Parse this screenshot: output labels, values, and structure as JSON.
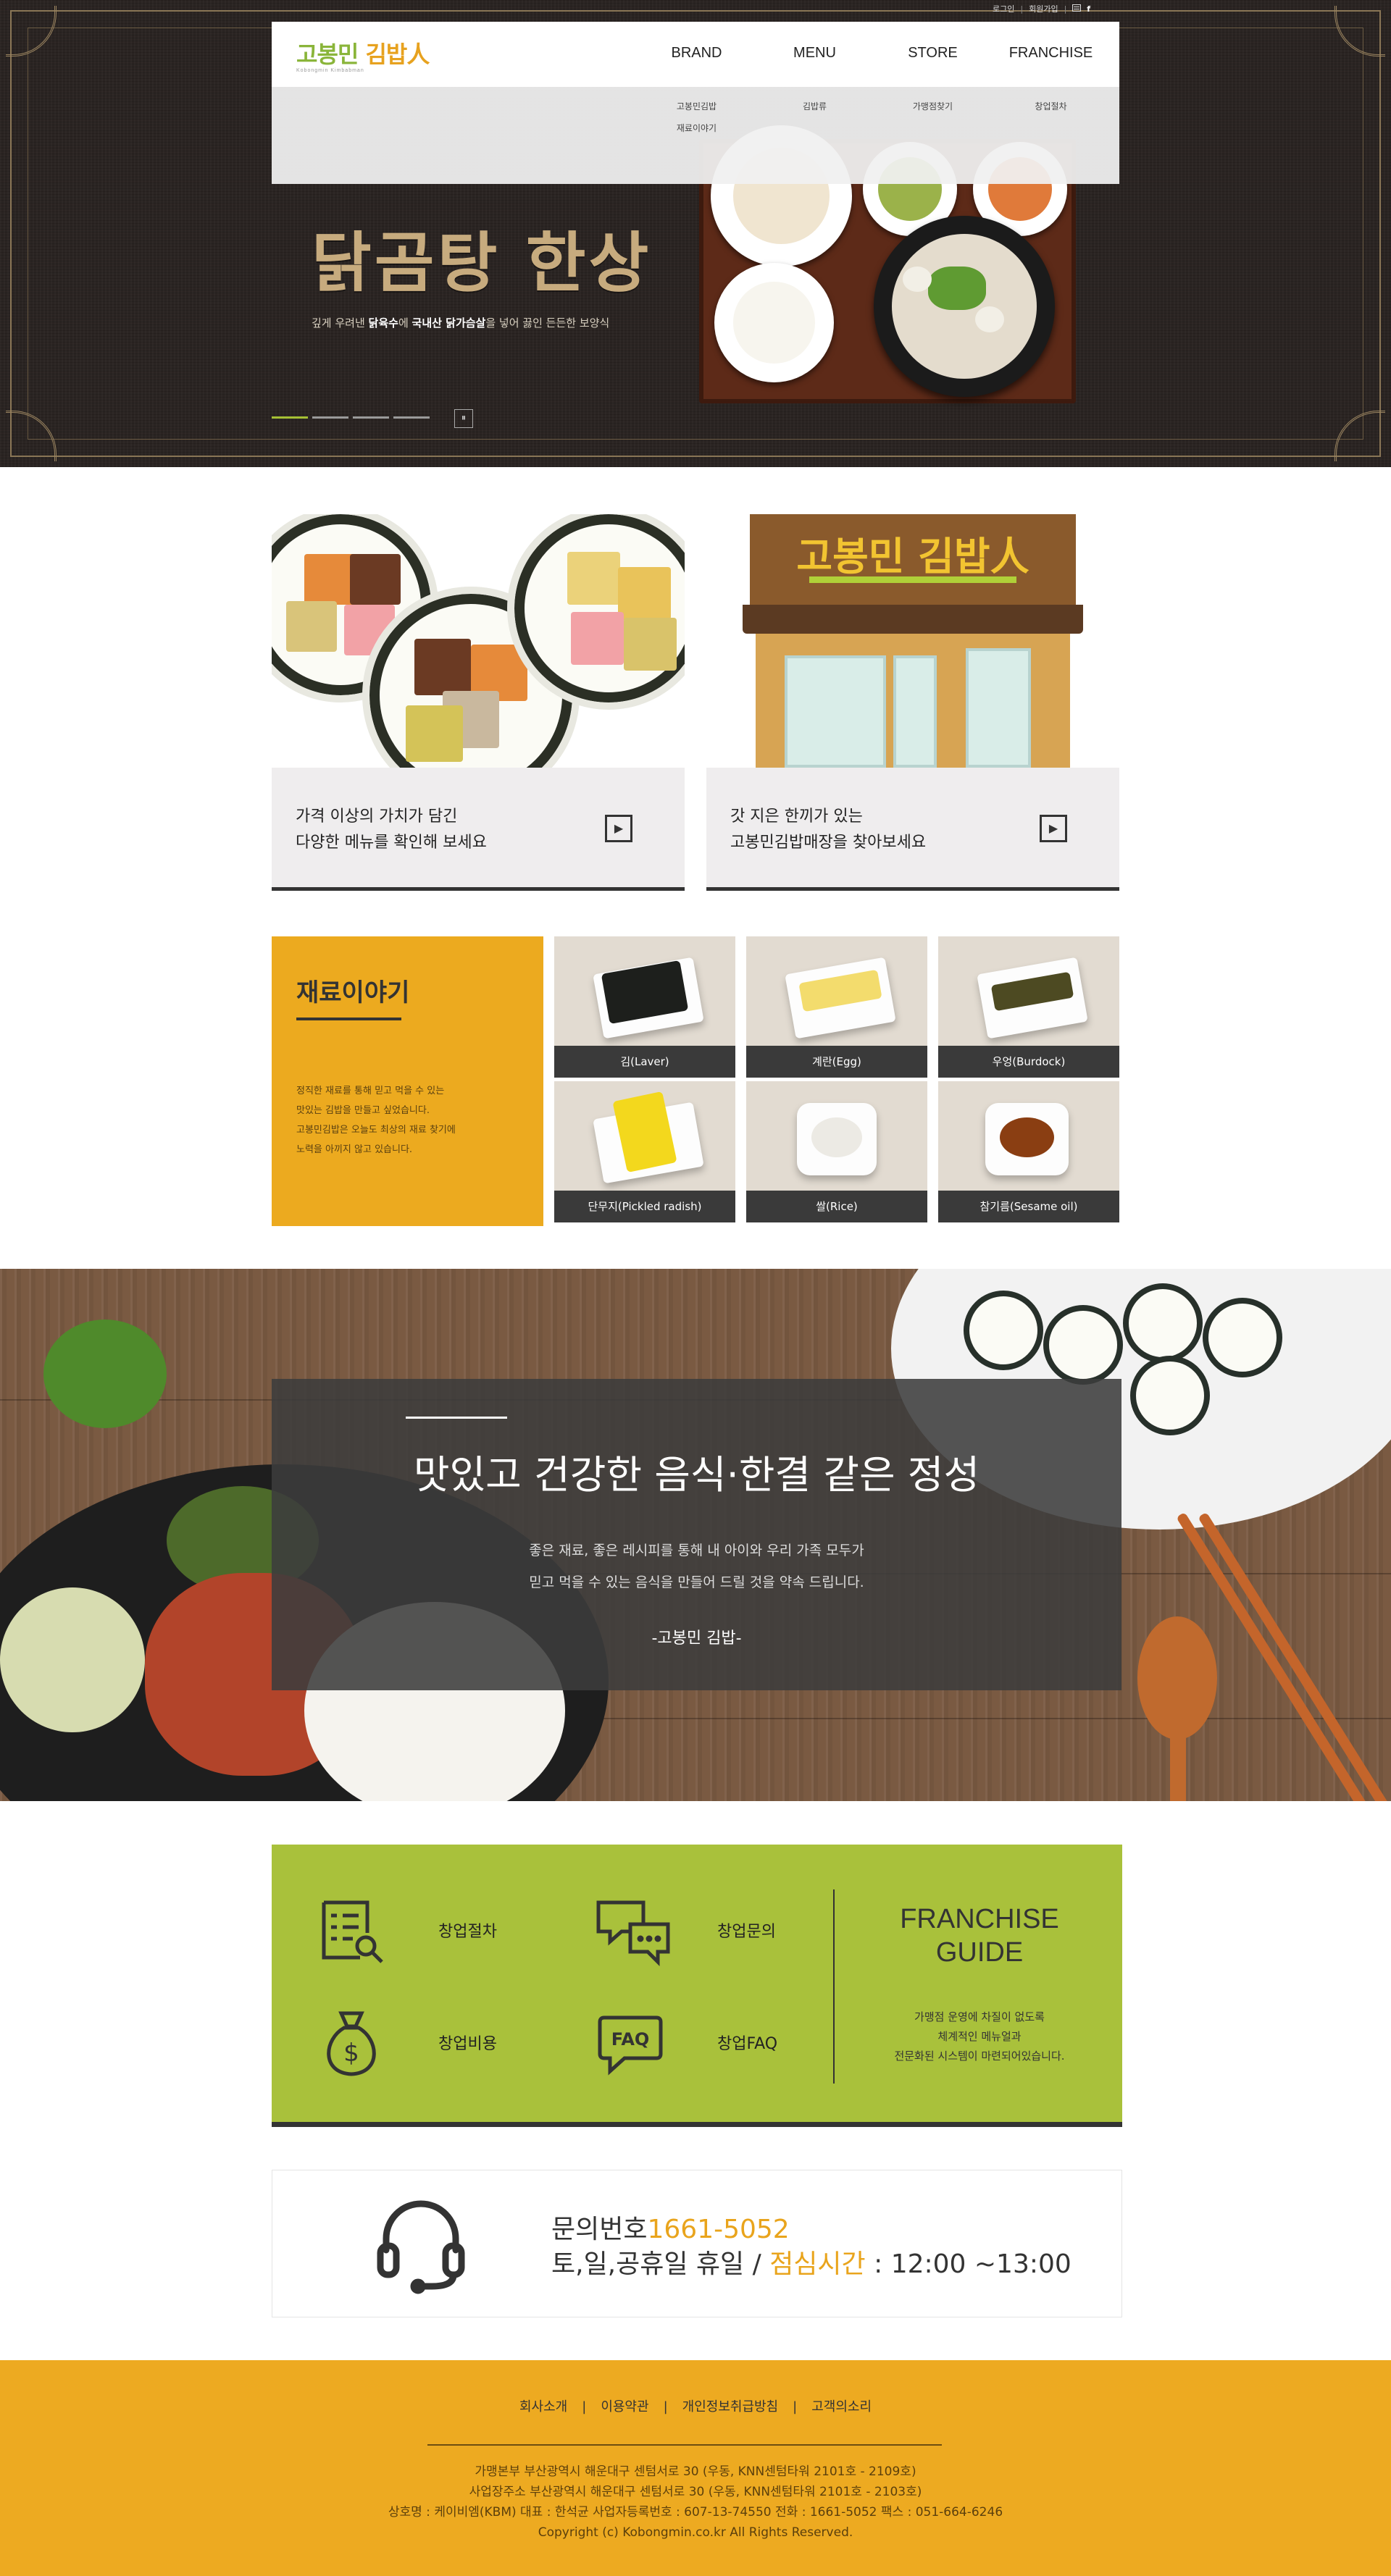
{
  "utility": {
    "login": "로그인",
    "join": "회원가입",
    "sitemap_icon": "sitemap-icon",
    "facebook_icon": "facebook-icon"
  },
  "logo": {
    "text_a": "고봉민 ",
    "text_b": "김밥人",
    "sub": "Kobongmin Kimbabman"
  },
  "nav": [
    {
      "label": "BRAND",
      "sub": [
        "고봉민김밥",
        "재료이야기"
      ]
    },
    {
      "label": "MENU",
      "sub": [
        "김밥류"
      ]
    },
    {
      "label": "STORE",
      "sub": [
        "가맹점찾기"
      ]
    },
    {
      "label": "FRANCHISE",
      "sub": [
        "창업절차"
      ]
    }
  ],
  "hero": {
    "title": "닭곰탕 한상",
    "sub_1": "깊게 우려낸 ",
    "sub_b1": "닭육수",
    "sub_2": "에 ",
    "sub_b2": "국내산 닭가슴살",
    "sub_3": "을 넣어 끓인 든든한 보양식",
    "pause": "⏸"
  },
  "cards": [
    {
      "line1": "가격 이상의 가치가 담긴",
      "line2": "다양한 메뉴를 확인해 보세요"
    },
    {
      "line1": "갓 지은 한끼가 있는",
      "line2": "고봉민김밥매장을 찾아보세요",
      "sign": "고봉민 김밥人"
    }
  ],
  "ingredients": {
    "title": "재료이야기",
    "desc": [
      "정직한 재료를 통해 믿고 먹을 수 있는",
      "맛있는 김밥을 만들고 싶었습니다.",
      "고봉민김밥은 오늘도 최상의 재료 찾기에",
      "노력을 아끼지 않고 있습니다."
    ],
    "items": [
      "김(Laver)",
      "계란(Egg)",
      "우엉(Burdock)",
      "단무지(Pickled radish)",
      "쌀(Rice)",
      "참기름(Sesame oil)"
    ]
  },
  "banner": {
    "title": "맛있고 건강한 음식·한결 같은 정성",
    "desc_1": "좋은 재료, 좋은 레시피를 통해 내 아이와 우리 가족 모두가",
    "desc_2": "믿고 먹을 수 있는 음식을 만들어 드릴 것을 약속 드립니다.",
    "sign": "-고봉민 김밥-"
  },
  "franchise": {
    "items": [
      {
        "label": "창업절차",
        "icon": "checklist-icon"
      },
      {
        "label": "창업문의",
        "icon": "chat-bubbles-icon"
      },
      {
        "label": "창업비용",
        "icon": "money-bag-icon"
      },
      {
        "label": "창업FAQ",
        "icon": "faq-icon"
      }
    ],
    "guide_title_1": "FRANCHISE",
    "guide_title_2": "GUIDE",
    "guide_desc": [
      "가맹점 운영에 차질이 없도록",
      "체계적인 메뉴얼과",
      "전문화된 시스템이 마련되어있습니다."
    ]
  },
  "contact": {
    "label": "문의번호",
    "phone": "1661-5052",
    "hours_label": "토,일,공휴일 휴일 / ",
    "lunch_label": "점심시간",
    "lunch_time": " : 12:00 ~13:00"
  },
  "footer": {
    "links": [
      "회사소개",
      "이용약관",
      "개인정보취급방침",
      "고객의소리"
    ],
    "sep": "|",
    "info": [
      "가맹본부 부산광역시 해운대구 센텀서로 30 (우동, KNN센텀타워 2101호 - 2109호)",
      "사업장주소 부산광역시 해운대구 센텀서로 30 (우동, KNN센텀타워 2101호 - 2103호)",
      "상호명 : 케이비엠(KBM) 대표 : 한석균 사업자등록번호 : 607-13-74550 전화 : 1661-5052 팩스 : 051-664-6246",
      "Copyright (c) Kobongmin.co.kr All Rights Reserved."
    ]
  },
  "colors": {
    "accent_green": "#a9c13b",
    "accent_orange": "#edaa21",
    "dark": "#333333"
  }
}
